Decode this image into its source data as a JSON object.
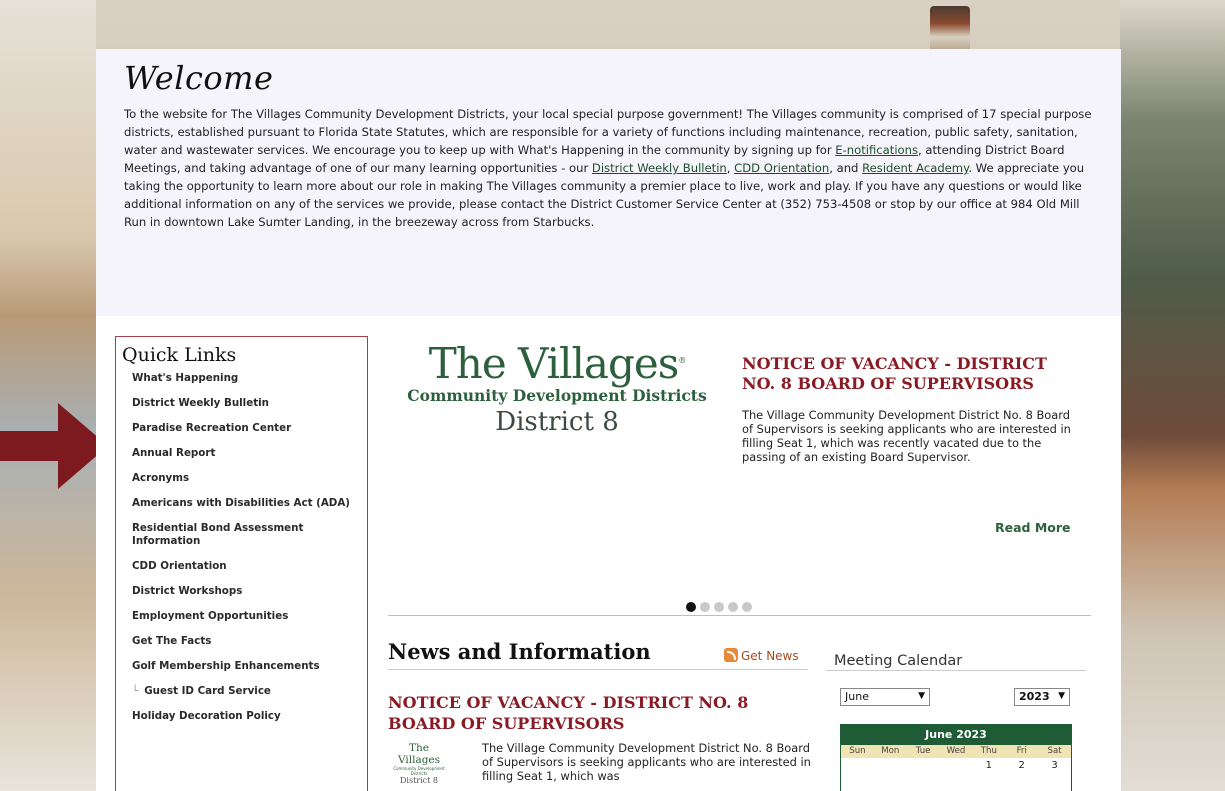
{
  "welcome": {
    "title": "Welcome",
    "text_1": "To the website for The Villages Community Development Districts, your local special purpose government!  The Villages community is comprised of 17 special purpose districts, established pursuant to Florida State Statutes, which are responsible for a variety of functions including maintenance, recreation, public safety, sanitation, water and wastewater services.  We encourage you to keep up with What's Happening in the community by signing up for ",
    "link_enotifications": "E-notifications",
    "text_2": ", attending District Board Meetings, and taking advantage of one of our many learning opportunities - our ",
    "link_bulletin": "District Weekly Bulletin",
    "text_3": ", ",
    "link_orientation": "CDD Orientation",
    "text_4": ", and ",
    "link_academy": "Resident Academy",
    "text_5": ".  We appreciate you taking the opportunity to learn more about our role in making The Villages community a premier place to live, work and play.  If you have any questions or would like additional information on any of the services we provide, please contact the District Customer Service Center at (352) 753-4508 or stop by our office at 984 Old Mill Run in downtown Lake Sumter Landing, in the breezeway across from Starbucks."
  },
  "quick_links": {
    "title": "Quick Links",
    "items": [
      "What's Happening",
      "District Weekly Bulletin",
      "Paradise Recreation Center",
      "Annual Report",
      "Acronyms",
      "Americans with Disabilities Act (ADA)",
      "Residential Bond Assessment Information",
      "CDD Orientation",
      "District Workshops",
      "Employment Opportunities",
      "Get The Facts",
      "Golf Membership Enhancements",
      "Guest ID Card Service",
      "Holiday Decoration Policy"
    ]
  },
  "logo": {
    "name": "The Villages",
    "subtitle": "Community Development Districts",
    "district": "District 8"
  },
  "slider": {
    "title": "NOTICE OF VACANCY - DISTRICT NO. 8 BOARD OF SUPERVISORS",
    "text": "The Village Community Development District No. 8 Board of Supervisors is seeking applicants who are interested in filling Seat 1, which was recently vacated due to the passing of an existing Board Supervisor.",
    "read_more": "Read More",
    "dot_count": 5,
    "active_dot": 1
  },
  "news": {
    "title": "News and Information",
    "get_news": "Get News",
    "item_title": "NOTICE OF VACANCY - DISTRICT NO. 8 BOARD OF SUPERVISORS",
    "item_text": "The Village Community Development District No. 8 Board of Supervisors is seeking applicants who are interested in filling Seat 1, which was"
  },
  "calendar": {
    "title": "Meeting Calendar",
    "month": "June",
    "year": "2023",
    "header": "June 2023",
    "days": [
      "Sun",
      "Mon",
      "Tue",
      "Wed",
      "Thu",
      "Fri",
      "Sat"
    ],
    "first_row": [
      "",
      "",
      "",
      "",
      "1",
      "2",
      "3"
    ]
  },
  "colors": {
    "accent_red": "#8a1a23",
    "brand_green": "#2c5f3c",
    "calendar_green": "#1f5b34",
    "arrow": "#7d1a1f"
  }
}
